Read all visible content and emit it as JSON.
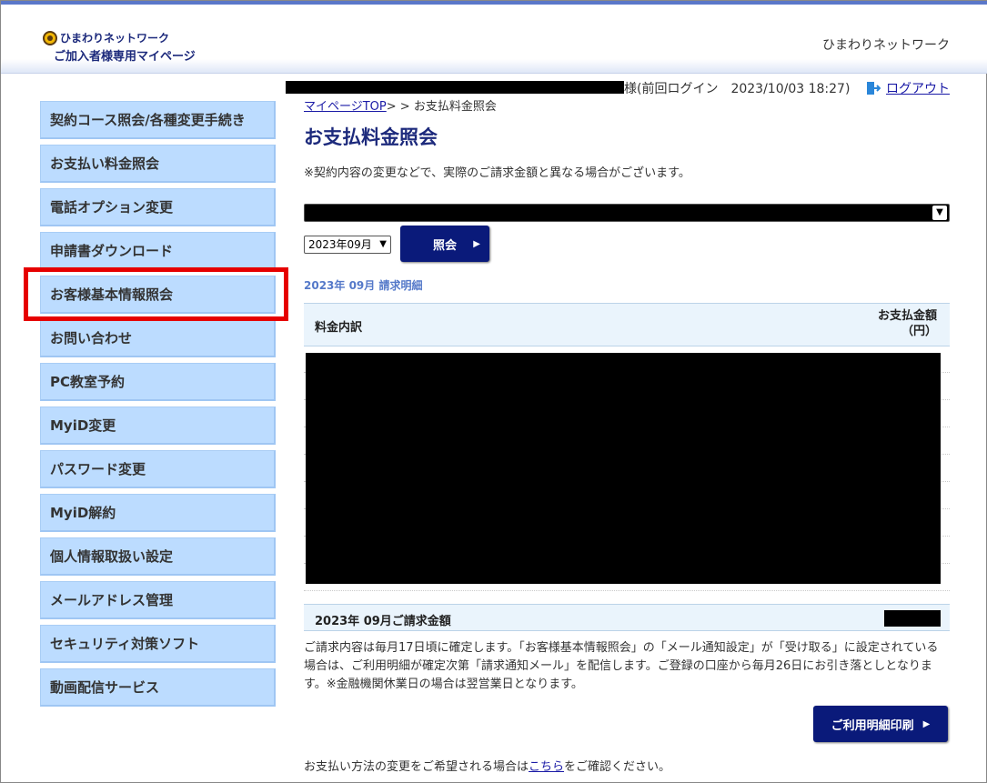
{
  "header": {
    "logo_line1": "ひまわりネットワーク",
    "logo_line2": "ご加入者様専用マイページ",
    "brand_right": "ひまわりネットワーク"
  },
  "sidebar": {
    "items": [
      {
        "label": "契約コース照会/各種変更手続き"
      },
      {
        "label": "お支払い料金照会"
      },
      {
        "label": "電話オプション変更"
      },
      {
        "label": "申請書ダウンロード"
      },
      {
        "label": "お客様基本情報照会"
      },
      {
        "label": "お問い合わせ"
      },
      {
        "label": "PC教室予約"
      },
      {
        "label": "MyiD変更"
      },
      {
        "label": "パスワード変更"
      },
      {
        "label": "MyiD解約"
      },
      {
        "label": "個人情報取扱い設定"
      },
      {
        "label": "メールアドレス管理"
      },
      {
        "label": "セキュリティ対策ソフト"
      },
      {
        "label": "動画配信サービス"
      }
    ],
    "highlighted": "お客様基本情報照会",
    "highlight_color": "#e60000"
  },
  "main": {
    "login_info": "様(前回ログイン　2023/10/03 18:27)",
    "logout_label": "ログアウト",
    "breadcrumb_link": "マイページTOP",
    "breadcrumb_sep": "> > ",
    "breadcrumb_current": "お支払料金照会",
    "title": "お支払料金照会",
    "notice": "※契約内容の変更などで、実際のご請求金額と異なる場合がございます。",
    "month_value": "2023年09月",
    "inquiry_button": "照会",
    "statement_label": "2023年 09月 請求明細",
    "table_header_left": "料金内訳",
    "table_header_right_1": "お支払金額",
    "table_header_right_2": "（円）",
    "total_label": "2023年 09月ご請求金額",
    "description": "ご請求内容は毎月17日頃に確定します。「お客様基本情報照会」の「メール通知設定」が「受け取る」に設定されている場合は、ご利用明細が確定次第「請求通知メール」を配信します。ご登録の口座から毎月26日にお引き落としとなります。※金融機関休業日の場合は翌営業日となります。",
    "print_button": "ご利用明細印刷",
    "footer_prefix": "お支払い方法の変更をご希望される場合は",
    "footer_link": "こちら",
    "footer_suffix": "をご確認ください。"
  },
  "colors": {
    "accent_navy": "#0a1a7a",
    "title_navy": "#1d2a7c",
    "sidebar_bg": "#bcdcff",
    "link": "#1a1aa6"
  }
}
